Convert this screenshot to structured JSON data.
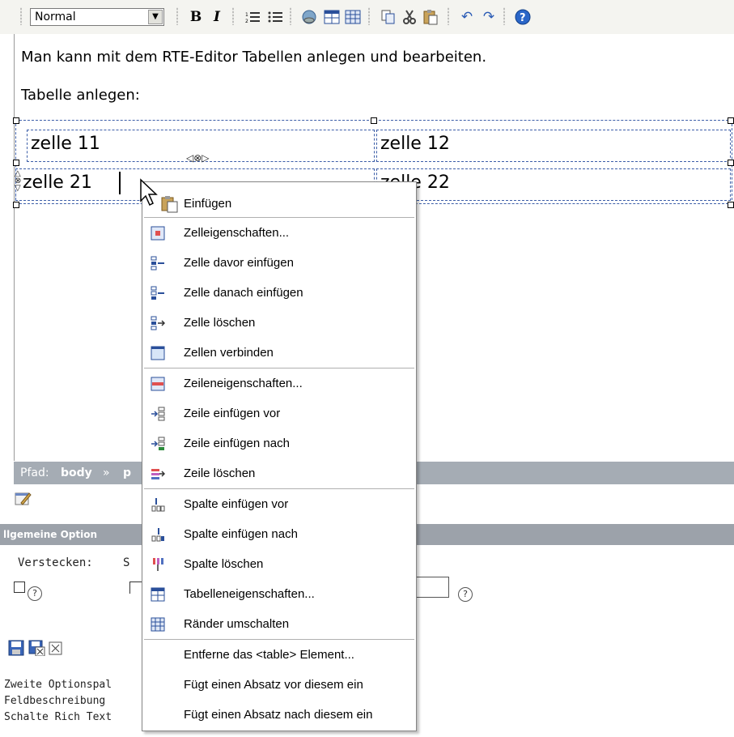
{
  "toolbar": {
    "format_select": "Normal",
    "buttons": [
      "bold-icon",
      "italic-icon",
      "ordered-list-icon",
      "unordered-list-icon",
      "insert-link-icon",
      "insert-table-icon",
      "table-grid-icon",
      "copy-icon",
      "cut-icon",
      "paste-icon",
      "undo-icon",
      "redo-icon",
      "help-icon"
    ],
    "bold_glyph": "B",
    "italic_glyph": "I"
  },
  "editor": {
    "line1": "Man kann mit dem RTE-Editor Tabellen anlegen und bearbeiten.",
    "line2": "Tabelle anlegen:",
    "table": {
      "rows": [
        [
          "zelle 11",
          "zelle 12"
        ],
        [
          "zelle 21",
          "zelle 22"
        ]
      ]
    }
  },
  "pathbar": {
    "label": "Pfad:",
    "body": "body",
    "sep": "»",
    "p": "p"
  },
  "options": {
    "header": "llgemeine Option",
    "hide_label": "Verstecken:",
    "hide_partial": "S",
    "help": "?"
  },
  "lower_text": {
    "l1": "Zweite Optionspal",
    "l2": "Feldbeschreibung",
    "l3": "Schalte Rich Text"
  },
  "context_menu": {
    "items": [
      {
        "label": "Einfügen",
        "icon": "paste-icon"
      },
      {
        "label": "Zelleigenschaften...",
        "icon": "cell-properties-icon"
      },
      {
        "label": "Zelle davor einfügen",
        "icon": "insert-cell-before-icon"
      },
      {
        "label": "Zelle danach einfügen",
        "icon": "insert-cell-after-icon"
      },
      {
        "label": "Zelle löschen",
        "icon": "delete-cell-icon"
      },
      {
        "label": "Zellen verbinden",
        "icon": "merge-cells-icon"
      },
      {
        "label": "Zeileneigenschaften...",
        "icon": "row-properties-icon"
      },
      {
        "label": "Zeile einfügen vor",
        "icon": "insert-row-before-icon"
      },
      {
        "label": "Zeile einfügen nach",
        "icon": "insert-row-after-icon"
      },
      {
        "label": "Zeile löschen",
        "icon": "delete-row-icon"
      },
      {
        "label": "Spalte einfügen vor",
        "icon": "insert-column-before-icon"
      },
      {
        "label": "Spalte einfügen nach",
        "icon": "insert-column-after-icon"
      },
      {
        "label": "Spalte löschen",
        "icon": "delete-column-icon"
      },
      {
        "label": "Tabelleneigenschaften...",
        "icon": "table-properties-icon"
      },
      {
        "label": "Ränder umschalten",
        "icon": "toggle-borders-icon"
      },
      {
        "label": "Entferne das <table> Element...",
        "icon": ""
      },
      {
        "label": "Fügt einen Absatz vor diesem ein",
        "icon": ""
      },
      {
        "label": "Fügt einen Absatz nach diesem ein",
        "icon": ""
      }
    ]
  }
}
